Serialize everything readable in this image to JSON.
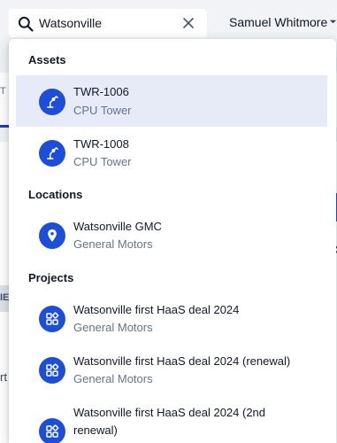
{
  "search": {
    "value": "Watsonville"
  },
  "user": {
    "name": "Samuel Whitmore"
  },
  "results": {
    "sections": {
      "assets": "Assets",
      "locations": "Locations",
      "projects": "Projects"
    },
    "assets": [
      {
        "title": "TWR-1006",
        "subtitle": "CPU Tower",
        "icon": "robot-arm-icon",
        "selected": true
      },
      {
        "title": "TWR-1008",
        "subtitle": "CPU Tower",
        "icon": "robot-arm-icon"
      }
    ],
    "locations": [
      {
        "title": "Watsonville GMC",
        "subtitle": "General Motors",
        "icon": "location-pin-icon"
      }
    ],
    "projects": [
      {
        "title": "Watsonville first HaaS deal 2024",
        "subtitle": "General Motors",
        "icon": "project-grid-icon"
      },
      {
        "title": "Watsonville first HaaS deal 2024 (renewal)",
        "subtitle": "General Motors",
        "icon": "project-grid-icon"
      },
      {
        "title": "Watsonville first HaaS deal 2024 (2nd renewal)",
        "subtitle": "",
        "icon": "project-grid-icon"
      }
    ]
  },
  "colors": {
    "accent": "#1d4ed8",
    "selected_row": "#e6ebf7",
    "muted_text": "#64748b"
  }
}
